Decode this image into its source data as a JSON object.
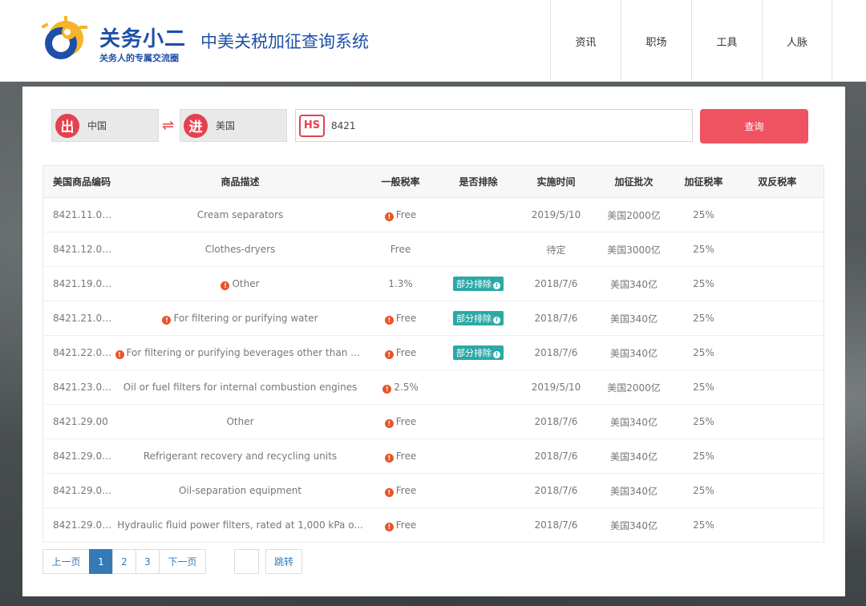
{
  "header": {
    "brand_name": "关务小二",
    "brand_slogan": "关务人的专属交流圈",
    "system_title": "中美关税加征查询系统",
    "nav": [
      "资讯",
      "职场",
      "工具",
      "人脉"
    ]
  },
  "search": {
    "export_badge": "出",
    "export_country": "中国",
    "swap_symbol": "⇌",
    "import_badge": "进",
    "import_country": "美国",
    "hs_label": "HS",
    "hs_value": "8421",
    "query_button": "查询"
  },
  "table": {
    "headers": [
      "美国商品编码",
      "商品描述",
      "一般税率",
      "是否排除",
      "实施时间",
      "加征批次",
      "加征税率",
      "双反税率"
    ],
    "rows": [
      {
        "code": "8421.11.00...",
        "desc": "Cream separators",
        "desc_warn": false,
        "rate": "Free",
        "rate_warn": true,
        "excl": "",
        "date": "2019/5/10",
        "batch": "美国2000亿",
        "add_rate": "25%",
        "ad": ""
      },
      {
        "code": "8421.12.00...",
        "desc": "Clothes-dryers",
        "desc_warn": false,
        "rate": "Free",
        "rate_warn": false,
        "excl": "",
        "date": "待定",
        "batch": "美国3000亿",
        "add_rate": "25%",
        "ad": ""
      },
      {
        "code": "8421.19.00...",
        "desc": "Other",
        "desc_warn": true,
        "rate": "1.3%",
        "rate_warn": false,
        "excl": "部分排除",
        "date": "2018/7/6",
        "batch": "美国340亿",
        "add_rate": "25%",
        "ad": ""
      },
      {
        "code": "8421.21.00...",
        "desc": "For filtering or purifying water",
        "desc_warn": true,
        "rate": "Free",
        "rate_warn": true,
        "excl": "部分排除",
        "date": "2018/7/6",
        "batch": "美国340亿",
        "add_rate": "25%",
        "ad": ""
      },
      {
        "code": "8421.22.00...",
        "desc": "For filtering or purifying beverages other than w...",
        "desc_warn": true,
        "rate": "Free",
        "rate_warn": true,
        "excl": "部分排除",
        "date": "2018/7/6",
        "batch": "美国340亿",
        "add_rate": "25%",
        "ad": ""
      },
      {
        "code": "8421.23.00...",
        "desc": "Oil or fuel filters for internal combustion engines",
        "desc_warn": false,
        "rate": "2.5%",
        "rate_warn": true,
        "excl": "",
        "date": "2019/5/10",
        "batch": "美国2000亿",
        "add_rate": "25%",
        "ad": ""
      },
      {
        "code": "8421.29.00",
        "desc": "Other",
        "desc_warn": false,
        "rate": "Free",
        "rate_warn": true,
        "excl": "",
        "date": "2018/7/6",
        "batch": "美国340亿",
        "add_rate": "25%",
        "ad": ""
      },
      {
        "code": "8421.29.00...",
        "desc": "Refrigerant recovery and recycling units",
        "desc_warn": false,
        "rate": "Free",
        "rate_warn": true,
        "excl": "",
        "date": "2018/7/6",
        "batch": "美国340亿",
        "add_rate": "25%",
        "ad": ""
      },
      {
        "code": "8421.29.00...",
        "desc": "Oil-separation equipment",
        "desc_warn": false,
        "rate": "Free",
        "rate_warn": true,
        "excl": "",
        "date": "2018/7/6",
        "batch": "美国340亿",
        "add_rate": "25%",
        "ad": ""
      },
      {
        "code": "8421.29.00...",
        "desc": "Hydraulic fluid power filters, rated at 1,000 kPa o...",
        "desc_warn": false,
        "rate": "Free",
        "rate_warn": true,
        "excl": "",
        "date": "2018/7/6",
        "batch": "美国340亿",
        "add_rate": "25%",
        "ad": ""
      }
    ]
  },
  "pagination": {
    "prev": "上一页",
    "pages": [
      "1",
      "2",
      "3"
    ],
    "current": "1",
    "next": "下一页",
    "jump": "跳转"
  },
  "watermark": "关务小二",
  "colors": {
    "accent_red": "#ef5361",
    "brand_blue": "#1e4fa8",
    "tag_teal": "#2aa9a6",
    "warn_orange": "#e8552a"
  }
}
